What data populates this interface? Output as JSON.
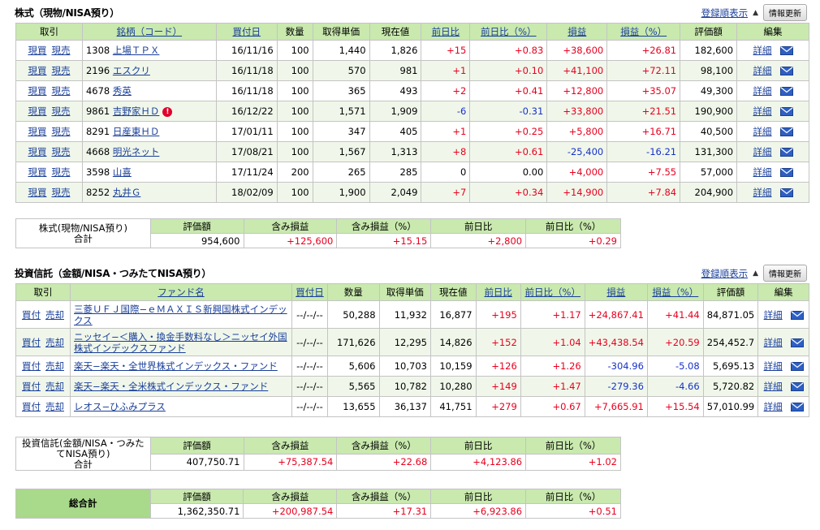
{
  "stocks": {
    "title": "株式（現物/NISA預り）",
    "sort_link": "登録順表示",
    "update_button": "情報更新",
    "headers": [
      "取引",
      "銘柄（コード）",
      "買付日",
      "数量",
      "取得単価",
      "現在値",
      "前日比",
      "前日比（%）",
      "損益",
      "損益（%）",
      "評価額",
      "編集"
    ],
    "buy_label": "現買",
    "sell_label": "現売",
    "detail_label": "詳細",
    "rows": [
      {
        "code": "1308",
        "name": "上場ＴＰＸ",
        "date": "16/11/16",
        "qty": "100",
        "cost": "1,440",
        "price": "1,826",
        "chg": "+15",
        "chg_pct": "+0.83",
        "pl": "+38,600",
        "pl_pct": "+26.81",
        "value": "182,600"
      },
      {
        "code": "2196",
        "name": "エスクリ",
        "date": "16/11/18",
        "qty": "100",
        "cost": "570",
        "price": "981",
        "chg": "+1",
        "chg_pct": "+0.10",
        "pl": "+41,100",
        "pl_pct": "+72.11",
        "value": "98,100"
      },
      {
        "code": "4678",
        "name": "秀英",
        "date": "16/11/18",
        "qty": "100",
        "cost": "365",
        "price": "493",
        "chg": "+2",
        "chg_pct": "+0.41",
        "pl": "+12,800",
        "pl_pct": "+35.07",
        "value": "49,300"
      },
      {
        "code": "9861",
        "name": "吉野家ＨＤ",
        "date": "16/12/22",
        "qty": "100",
        "cost": "1,571",
        "price": "1,909",
        "chg": "-6",
        "chg_pct": "-0.31",
        "pl": "+33,800",
        "pl_pct": "+21.51",
        "value": "190,900",
        "warn": "!"
      },
      {
        "code": "8291",
        "name": "日産東ＨＤ",
        "date": "17/01/11",
        "qty": "100",
        "cost": "347",
        "price": "405",
        "chg": "+1",
        "chg_pct": "+0.25",
        "pl": "+5,800",
        "pl_pct": "+16.71",
        "value": "40,500"
      },
      {
        "code": "4668",
        "name": "明光ネット",
        "date": "17/08/21",
        "qty": "100",
        "cost": "1,567",
        "price": "1,313",
        "chg": "+8",
        "chg_pct": "+0.61",
        "pl": "-25,400",
        "pl_pct": "-16.21",
        "value": "131,300"
      },
      {
        "code": "3598",
        "name": "山喜",
        "date": "17/11/24",
        "qty": "200",
        "cost": "265",
        "price": "285",
        "chg": "0",
        "chg_pct": "0.00",
        "pl": "+4,000",
        "pl_pct": "+7.55",
        "value": "57,000"
      },
      {
        "code": "8252",
        "name": "丸井Ｇ",
        "date": "18/02/09",
        "qty": "100",
        "cost": "1,900",
        "price": "2,049",
        "chg": "+7",
        "chg_pct": "+0.34",
        "pl": "+14,900",
        "pl_pct": "+7.84",
        "value": "204,900"
      }
    ],
    "summary": {
      "label_line1": "株式(現物/NISA預り)",
      "label_line2": "合計",
      "headers": [
        "評価額",
        "含み損益",
        "含み損益（%）",
        "前日比",
        "前日比（%）"
      ],
      "values": [
        "954,600",
        "+125,600",
        "+15.15",
        "+2,800",
        "+0.29"
      ]
    }
  },
  "funds": {
    "title": "投資信託（金額/NISA・つみたてNISA預り）",
    "sort_link": "登録順表示",
    "update_button": "情報更新",
    "headers": [
      "取引",
      "ファンド名",
      "買付日",
      "数量",
      "取得単価",
      "現在値",
      "前日比",
      "前日比（%）",
      "損益",
      "損益（%）",
      "評価額",
      "編集"
    ],
    "buy_label": "買付",
    "sell_label": "売却",
    "detail_label": "詳細",
    "rows": [
      {
        "name": "三菱ＵＦＪ国際−ｅＭＡＸＩＳ新興国株式インデックス",
        "date": "--/--/--",
        "qty": "50,288",
        "cost": "11,932",
        "price": "16,877",
        "chg": "+195",
        "chg_pct": "+1.17",
        "pl": "+24,867.41",
        "pl_pct": "+41.44",
        "value": "84,871.05"
      },
      {
        "name": "ニッセイ−＜購入・換金手数料なし＞ニッセイ外国株式インデックスファンド",
        "date": "--/--/--",
        "qty": "171,626",
        "cost": "12,295",
        "price": "14,826",
        "chg": "+152",
        "chg_pct": "+1.04",
        "pl": "+43,438.54",
        "pl_pct": "+20.59",
        "value": "254,452.7"
      },
      {
        "name": "楽天−楽天・全世界株式インデックス・ファンド",
        "date": "--/--/--",
        "qty": "5,606",
        "cost": "10,703",
        "price": "10,159",
        "chg": "+126",
        "chg_pct": "+1.26",
        "pl": "-304.96",
        "pl_pct": "-5.08",
        "value": "5,695.13"
      },
      {
        "name": "楽天−楽天・全米株式インデックス・ファンド",
        "date": "--/--/--",
        "qty": "5,565",
        "cost": "10,782",
        "price": "10,280",
        "chg": "+149",
        "chg_pct": "+1.47",
        "pl": "-279.36",
        "pl_pct": "-4.66",
        "value": "5,720.82"
      },
      {
        "name": "レオス−ひふみプラス",
        "date": "--/--/--",
        "qty": "13,655",
        "cost": "36,137",
        "price": "41,751",
        "chg": "+279",
        "chg_pct": "+0.67",
        "pl": "+7,665.91",
        "pl_pct": "+15.54",
        "value": "57,010.99"
      }
    ],
    "summary": {
      "label_line1": "投資信託(金額/NISA・つみた",
      "label_line2": "てNISA預り)",
      "label_line3": "合計",
      "headers": [
        "評価額",
        "含み損益",
        "含み損益（%）",
        "前日比",
        "前日比（%）"
      ],
      "values": [
        "407,750.71",
        "+75,387.54",
        "+22.68",
        "+4,123.86",
        "+1.02"
      ]
    }
  },
  "grand_total": {
    "label": "総合計",
    "headers": [
      "評価額",
      "含み損益",
      "含み損益（%）",
      "前日比",
      "前日比（%）"
    ],
    "values": [
      "1,362,350.71",
      "+200,987.54",
      "+17.31",
      "+6,923.86",
      "+0.51"
    ]
  },
  "colors": {
    "header_bg": "#c9e9ae",
    "positive": "#e8001e",
    "negative": "#1832c8",
    "link": "#1a3f9a"
  },
  "icons": {
    "mail": "mail-icon",
    "warning": "warning-icon",
    "sort": "triangle-icon"
  }
}
